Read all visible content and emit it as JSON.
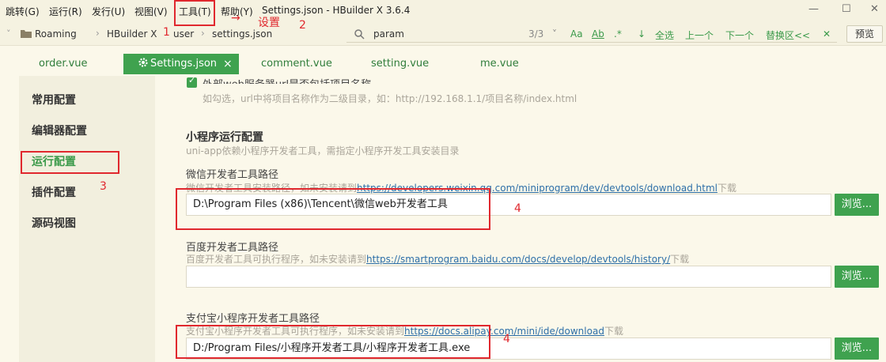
{
  "menubar": {
    "items": [
      "跳转(G)",
      "运行(R)",
      "发行(U)",
      "视图(V)",
      "工具(T)",
      "帮助(Y)"
    ],
    "title": "Settings.json - HBuilder X 3.6.4",
    "minimize": "—",
    "maximize": "☐",
    "close": "✕"
  },
  "toolbar": {
    "crumbs": [
      "Roaming",
      "HBuilder X",
      "user",
      "settings.json"
    ],
    "search_value": "param",
    "match_count": "3/3",
    "aa": "Aa",
    "ab": "Ab",
    "regex": ".*",
    "select_all": "全选",
    "prev": "上一个",
    "next": "下一个",
    "replace": "替换区<<",
    "preview": "预览"
  },
  "tabs": [
    "order.vue",
    "Settings.json",
    "comment.vue",
    "setting.vue",
    "me.vue"
  ],
  "sidebar": {
    "items": [
      "常用配置",
      "编辑器配置",
      "运行配置",
      "插件配置",
      "源码视图"
    ]
  },
  "content": {
    "cut_label": "外部web服务器url是否包括项目名称",
    "cut_hint": "如勾选，url中将项目名称作为二级目录，如：http://192.168.1.1/项目名称/index.html",
    "section_title": "小程序运行配置",
    "section_hint": "uni-app依赖小程序开发者工具，需指定小程序开发工具安装目录",
    "wechat": {
      "label": "微信开发者工具路径",
      "hint_prefix": "微信开发者工具安装路径，如未安装请到",
      "hint_link": "https://developers.weixin.qq.com/miniprogram/dev/devtools/download.html",
      "hint_suffix": "下载",
      "value": "D:\\Program Files (x86)\\Tencent\\微信web开发者工具"
    },
    "baidu": {
      "label": "百度开发者工具路径",
      "hint_prefix": "百度开发者工具可执行程序，如未安装请到",
      "hint_link": "https://smartprogram.baidu.com/docs/develop/devtools/history/",
      "hint_suffix": "下载",
      "value": ""
    },
    "alipay": {
      "label": "支付宝小程序开发者工具路径",
      "hint_prefix": "支付宝小程序开发者工具可执行程序，如未安装请到",
      "hint_link": "https://docs.alipay.com/mini/ide/download",
      "hint_suffix": "下载",
      "value": "D:/Program Files/小程序开发者工具/小程序开发者工具.exe"
    },
    "browse": "浏览..."
  },
  "annotations": {
    "num1": "1",
    "num2": "2",
    "settings_text": "设置",
    "num3": "3",
    "num4a": "4",
    "num4b": "4",
    "arrow": "→"
  },
  "colors": {
    "accent": "#3fa24f",
    "annotation": "#e0282e",
    "background": "#fbf8ea"
  }
}
